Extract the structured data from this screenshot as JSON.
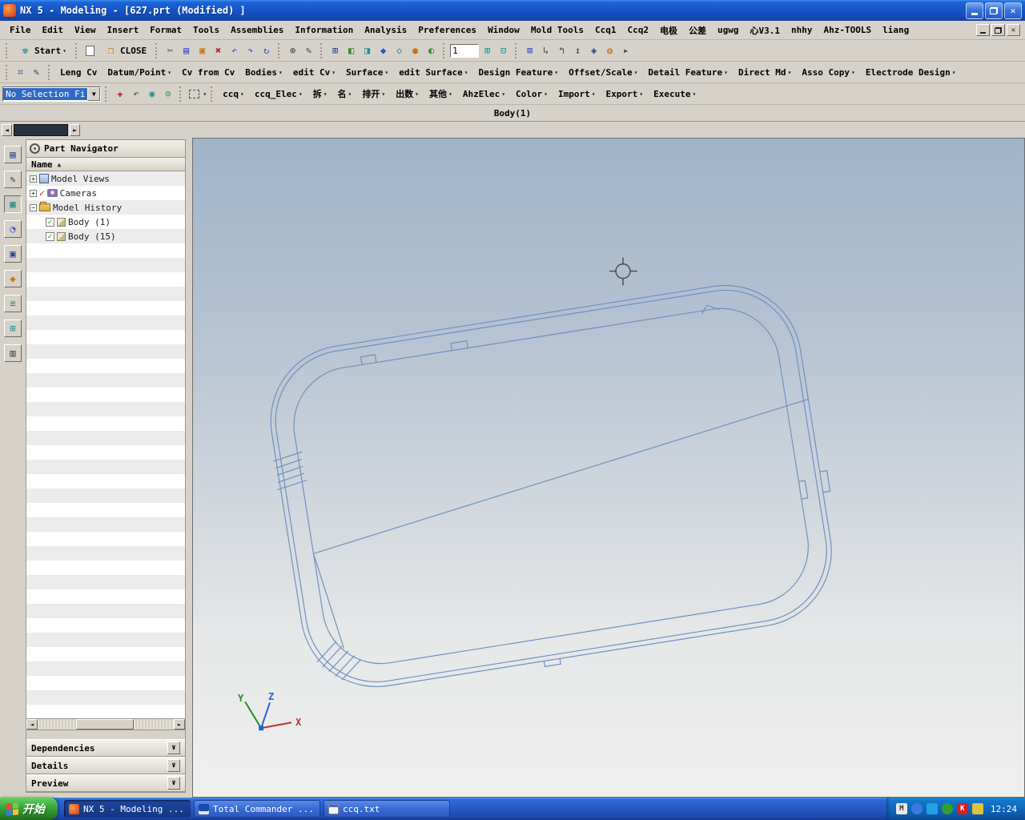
{
  "window": {
    "title": "NX 5 - Modeling - [627.prt (Modified) ]"
  },
  "menu": {
    "items": [
      "File",
      "Edit",
      "View",
      "Insert",
      "Format",
      "Tools",
      "Assemblies",
      "Information",
      "Analysis",
      "Preferences",
      "Window",
      "Mold Tools",
      "Ccq1",
      "Ccq2",
      "电极",
      "公差",
      "ugwg",
      "心V3.1",
      "nhhy",
      "Ahz-TOOLS",
      "liang"
    ]
  },
  "toolbar_main": {
    "start": "Start",
    "close": "CLOSE",
    "field_value": "1"
  },
  "toolbar_feature": {
    "items": [
      "Leng Cv",
      "Datum/Point",
      "Cv from Cv",
      "Bodies",
      "edit Cv",
      "Surface",
      "edit Surface",
      "Design Feature",
      "Offset/Scale",
      "Detail Feature",
      "Direct Md",
      "Asso Copy",
      "Electrode Design"
    ]
  },
  "selection_bar": {
    "filter": "No Selection Fi",
    "buttons": [
      "ccq",
      "ccq_Elec",
      "拆",
      "名",
      "排开",
      "出数",
      "其他",
      "AhzElec",
      "Color",
      "Import",
      "Export",
      "Execute"
    ]
  },
  "tab": {
    "label": "Body(1)"
  },
  "navigator": {
    "title": "Part Navigator",
    "name_column": "Name",
    "rows": [
      {
        "label": "Model Views"
      },
      {
        "label": "Cameras"
      },
      {
        "label": "Model History"
      },
      {
        "label": "Body (1)"
      },
      {
        "label": "Body (15)"
      }
    ],
    "sections": {
      "dependencies": "Dependencies",
      "details": "Details",
      "preview": "Preview"
    }
  },
  "viewport": {
    "axes": {
      "x": "X",
      "y": "Y",
      "z": "Z"
    }
  },
  "taskbar": {
    "start": "开始",
    "tasks": [
      {
        "label": "NX 5 - Modeling ..."
      },
      {
        "label": "Total Commander ..."
      },
      {
        "label": "ccq.txt"
      }
    ],
    "clock": "12:24"
  },
  "colors": {
    "accent": "#316ac5",
    "model_line": "#6f92c0",
    "axis_x": "#c03030",
    "axis_y": "#2a8a2a",
    "axis_z": "#2a62d8"
  }
}
